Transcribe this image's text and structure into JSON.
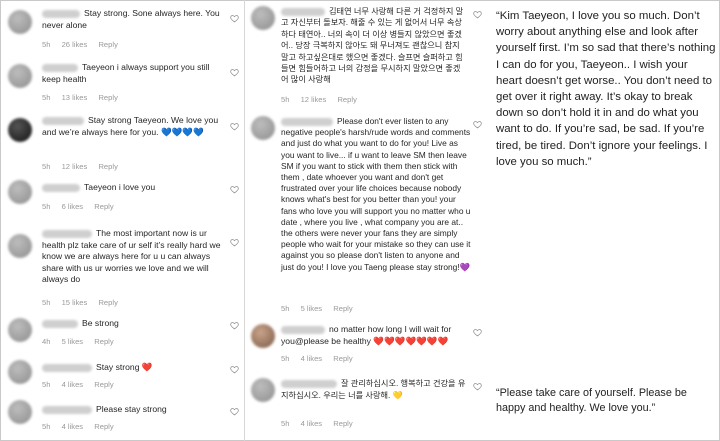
{
  "col1": [
    {
      "text": "Stay strong. Sone always here. You never alone",
      "time": "5h",
      "likes": "26 likes",
      "reply": "Reply"
    },
    {
      "text": "Taeyeon i always support you still keep health",
      "time": "5h",
      "likes": "13 likes",
      "reply": "Reply"
    },
    {
      "text": "Stay strong Taeyeon. We love you and we’re always here for you.",
      "emoji": "💙💙💙💙",
      "time": "5h",
      "likes": "12 likes",
      "reply": "Reply"
    },
    {
      "text": "Taeyeon i love you",
      "time": "5h",
      "likes": "6 likes",
      "reply": "Reply"
    },
    {
      "text": "The most important now is ur health plz take care of ur self it’s really hard we know we are always here for u u can always share with us ur worries we love and we will always do",
      "time": "5h",
      "likes": "15 likes",
      "reply": "Reply"
    },
    {
      "text": "Be strong",
      "time": "4h",
      "likes": "5 likes",
      "reply": "Reply"
    },
    {
      "text": "Stay strong",
      "emoji": "❤️",
      "time": "5h",
      "likes": "4 likes",
      "reply": "Reply"
    },
    {
      "text": "Please stay strong",
      "time": "5h",
      "likes": "4 likes",
      "reply": "Reply"
    }
  ],
  "col2": [
    {
      "text": "김태연 너무 사랑해 다른 거 걱정하지 말고 자신부터 돌보자. 해줄 수 있는 게 없어서 너무 속상하다 태연아.. 너의 속이 더 이상 병들지 않았으면 좋겠어.. 당장 극복하지 않아도 돼 무너져도 괜찮으니 참지말고 하고싶은대로 했으면 좋겠다. 슬프면 슬퍼하고 힘들면 힘들어하고 너의 감정을 무시하지 말았으면 좋겠어 많이 사랑해",
      "time": "5h",
      "likes": "12 likes",
      "reply": "Reply"
    },
    {
      "text": "Please don't ever listen to any negative people's harsh/rude words and comments and just do what you want to do for you! Live as you want to live... if u want to leave SM then leave SM if you want to stick with them then stick with them , date whoever you want and don't get frustrated over your life choices because nobody knows what's best for you better than you! your fans who love you will support you no matter who u date , where you live , what company you are at.. the others were never your fans they are simply people who wait for your mistake so they can use it against you so please don't listen to anyone and just do you! I love you Taeng please stay strong!",
      "emoji": "💜",
      "time": "5h",
      "likes": "5 likes",
      "reply": "Reply"
    },
    {
      "text": "no matter how long I will wait for you@please be healthy",
      "emoji": "❤️❤️❤️❤️❤️❤️❤️",
      "time": "5h",
      "likes": "4 likes",
      "reply": "Reply"
    },
    {
      "text": "잘 관리하십시오. 행복하고 건강을 유지하십시오. 우리는 너를 사랑해.",
      "emoji": "💛",
      "time": "5h",
      "likes": "4 likes",
      "reply": "Reply"
    }
  ],
  "quote1": "“Kim Taeyeon, I love you so much. Don’t worry about anything else and look after yourself first. I’m so sad that there’s nothing I can do for you, Taeyeon.. I wish your heart doesn’t get worse.. You don’t need to get over it right away. It’s okay to break down so don’t hold it in and do what you want to do. If you’re sad, be sad. If you’re tired, be tired. Don’t ignore your feelings. I love you so much.”",
  "quote2": "“Please take care of yourself. Please be happy and healthy. We love you.”"
}
